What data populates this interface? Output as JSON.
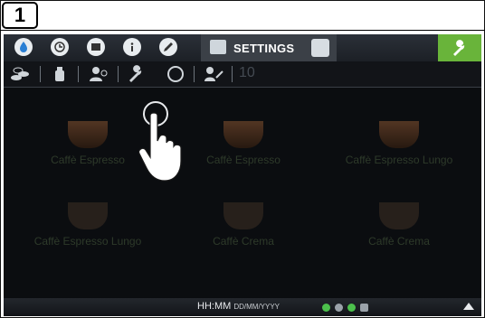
{
  "step": {
    "number": "1"
  },
  "toolbar": {
    "icons": [
      "water-drop-icon",
      "clock-icon",
      "folder-icon",
      "info-icon",
      "pencil-icon"
    ],
    "settings_label": "SETTINGS",
    "wrench_color": "#69b43a"
  },
  "subbar": {
    "icons": [
      "coins-icon",
      "bottle-icon",
      "user-settings-icon",
      "wrench-settings-icon",
      "circle-arrows-icon",
      "service-key-icon"
    ],
    "number": "10"
  },
  "beverages": [
    {
      "label": "Caffè Espresso"
    },
    {
      "label": "Caffè Espresso"
    },
    {
      "label": "Caffè Espresso Lungo"
    },
    {
      "label": "Caffè Espresso Lungo"
    },
    {
      "label": "Caffè Crema"
    },
    {
      "label": "Caffè Crema"
    }
  ],
  "status": {
    "time": "HH:MM",
    "date": "DD/MM/YYYY"
  }
}
